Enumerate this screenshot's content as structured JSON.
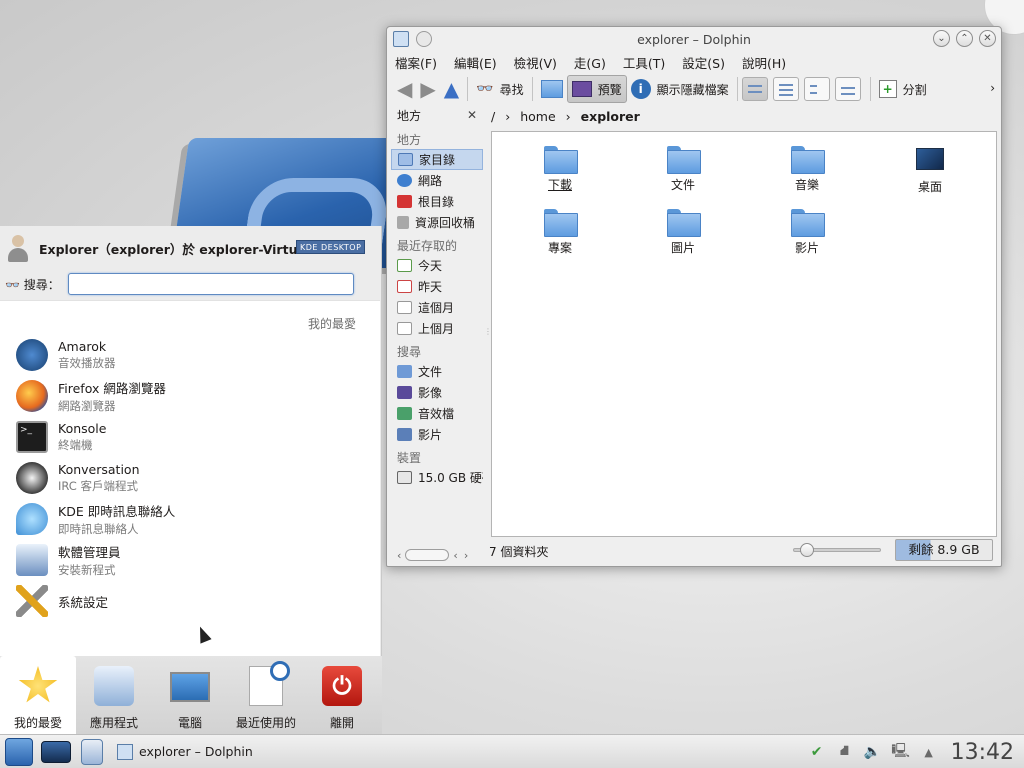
{
  "dolphin": {
    "title": "explorer – Dolphin",
    "menu": [
      "檔案(F)",
      "編輯(E)",
      "檢視(V)",
      "走(G)",
      "工具(T)",
      "設定(S)",
      "說明(H)"
    ],
    "toolbar": {
      "find": "尋找",
      "preview": "預覽",
      "show_hidden": "顯示隱藏檔案",
      "split": "分割"
    },
    "places": {
      "header": "地方",
      "sections": {
        "places": "地方",
        "recent": "最近存取的",
        "search": "搜尋",
        "devices": "裝置"
      },
      "places_items": [
        "家目錄",
        "網路",
        "根目錄",
        "資源回收桶"
      ],
      "recent_items": [
        "今天",
        "昨天",
        "這個月",
        "上個月"
      ],
      "search_items": [
        "文件",
        "影像",
        "音效檔",
        "影片"
      ],
      "device_items": [
        "15.0 GB 硬碟"
      ]
    },
    "breadcrumb": [
      "/",
      "home",
      "explorer"
    ],
    "items": [
      {
        "label": "下載",
        "type": "folder"
      },
      {
        "label": "文件",
        "type": "folder"
      },
      {
        "label": "音樂",
        "type": "folder"
      },
      {
        "label": "桌面",
        "type": "desktop"
      },
      {
        "label": "專案",
        "type": "folder"
      },
      {
        "label": "圖片",
        "type": "folder"
      },
      {
        "label": "影片",
        "type": "folder"
      }
    ],
    "status": {
      "count": "7 個資料夾",
      "free": "剩餘 8.9 GB",
      "used_fraction": 0.36
    }
  },
  "kickoff": {
    "user": "Explorer（explorer）於 explorer-VirtualBo",
    "badge": "KDE DESKTOP",
    "search_label": "搜尋：",
    "search_value": "",
    "favorites_header": "我的最愛",
    "apps": [
      {
        "name": "Amarok",
        "desc": "音效播放器",
        "icon": "amarok-icon",
        "color": "#1f5a99"
      },
      {
        "name": "Firefox 網路瀏覽器",
        "desc": "網路瀏覽器",
        "icon": "firefox-icon",
        "color": "#e66a1f"
      },
      {
        "name": "Konsole",
        "desc": "終端機",
        "icon": "terminal-icon",
        "color": "#2b2b2b"
      },
      {
        "name": "Konversation",
        "desc": "IRC 客戶端程式",
        "icon": "megaphone-icon",
        "color": "#3b3b3b"
      },
      {
        "name": "KDE 即時訊息聯絡人",
        "desc": "即時訊息聯絡人",
        "icon": "chat-bubble-icon",
        "color": "#3f8fd5"
      },
      {
        "name": "軟體管理員",
        "desc": "安裝新程式",
        "icon": "package-icon",
        "color": "#6b8fc0"
      },
      {
        "name": "系統設定",
        "desc": "",
        "icon": "tools-icon",
        "color": "#7a7a7a"
      }
    ],
    "tabs": [
      "我的最愛",
      "應用程式",
      "電腦",
      "最近使用的",
      "離開"
    ]
  },
  "taskbar": {
    "task": "explorer – Dolphin",
    "clock": "13:42"
  }
}
